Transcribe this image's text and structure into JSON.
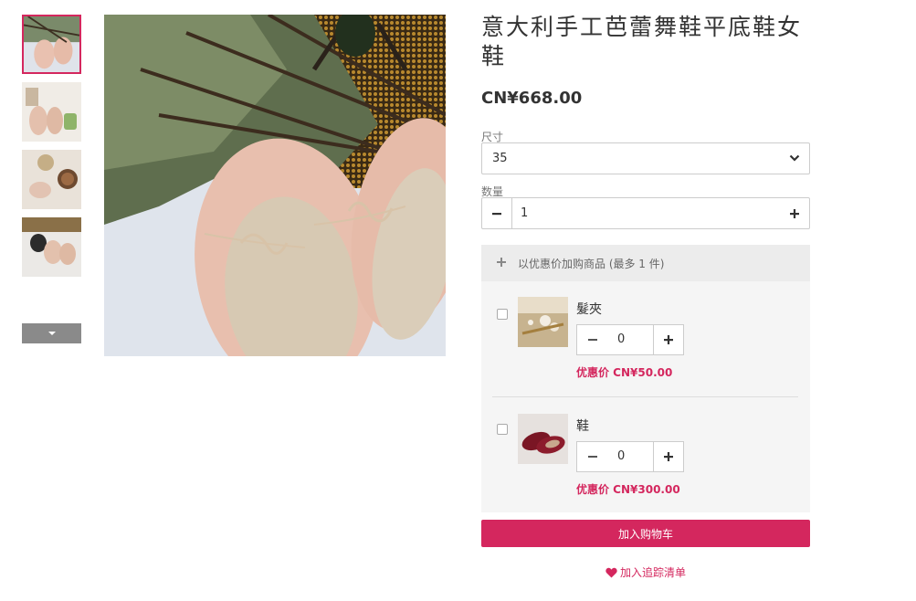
{
  "gallery": {
    "thumbnails": [
      {
        "alt": "thumb-1",
        "active": true
      },
      {
        "alt": "thumb-2",
        "active": false
      },
      {
        "alt": "thumb-3",
        "active": false
      },
      {
        "alt": "thumb-4",
        "active": false
      }
    ],
    "scroll_icon": "caret-down-icon"
  },
  "product": {
    "title": "意大利手工芭蕾舞鞋平底鞋女鞋",
    "price": "CN¥668.00"
  },
  "options": {
    "size_label": "尺寸",
    "size_value": "35",
    "quantity_label": "数量",
    "quantity_value": "1"
  },
  "addon": {
    "header": "以优惠价加购商品 (最多 1 件)",
    "items": [
      {
        "name": "髮夾",
        "quantity": "0",
        "deal_price": "优惠价 CN¥50.00"
      },
      {
        "name": "鞋",
        "quantity": "0",
        "deal_price": "优惠价 CN¥300.00"
      }
    ]
  },
  "actions": {
    "add_to_cart": "加入购物车",
    "wishlist": "加入追踪清单"
  },
  "colors": {
    "accent": "#d4275e",
    "panel": "#f5f5f5",
    "panel_header": "#ececec"
  }
}
